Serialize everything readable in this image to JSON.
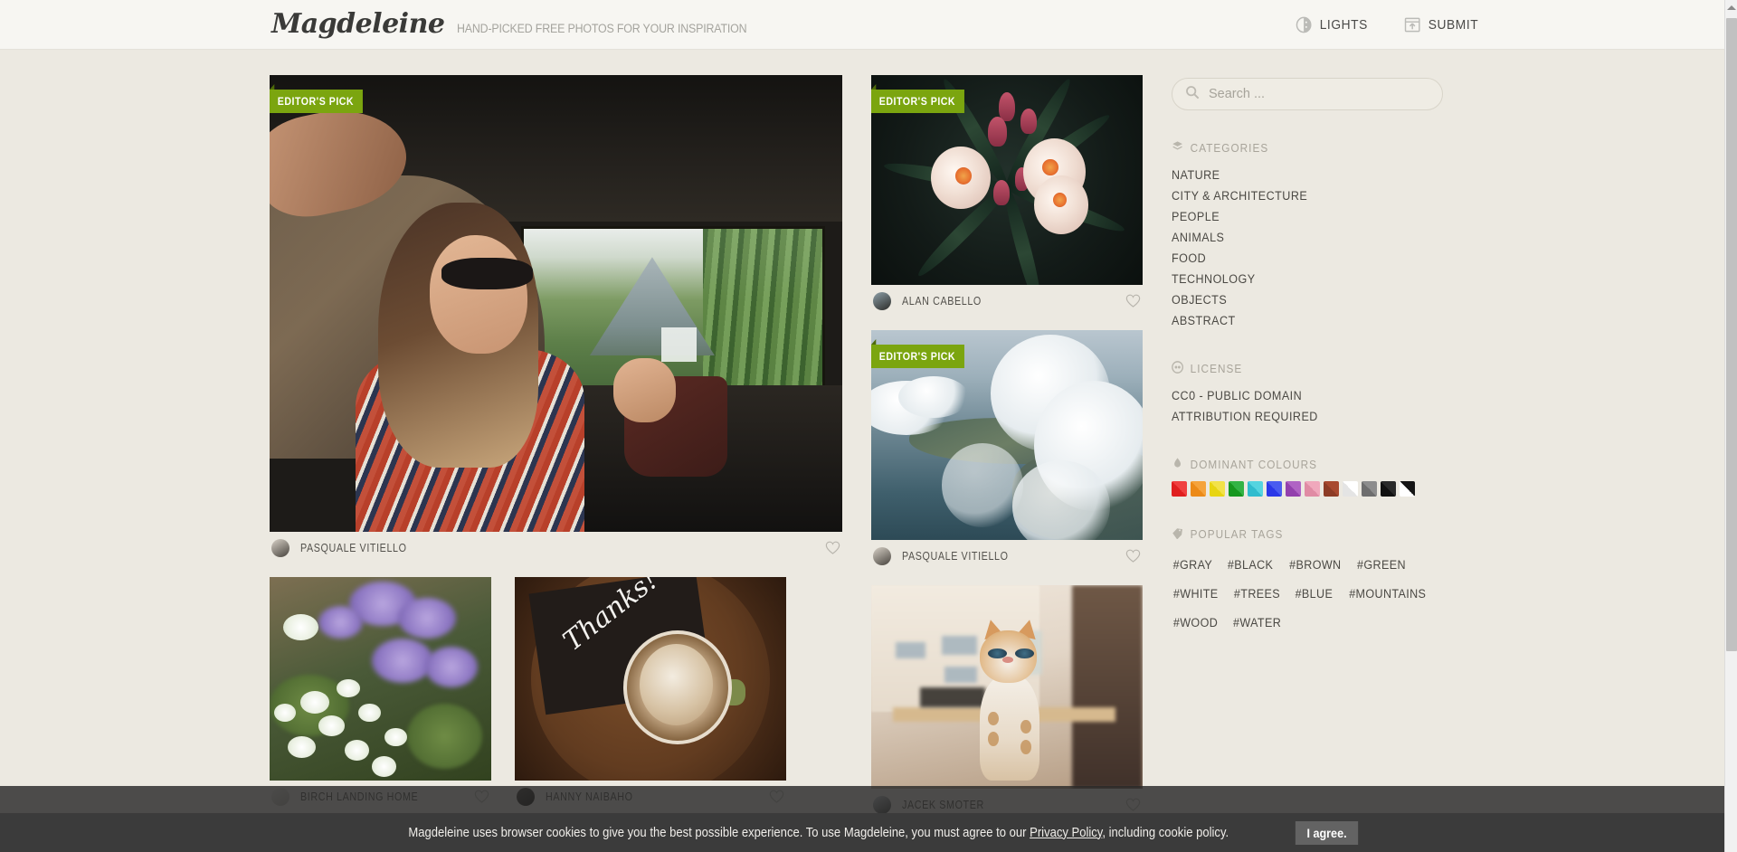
{
  "header": {
    "logo": "Magdeleine",
    "tagline": "HAND-PICKED FREE PHOTOS FOR YOUR INSPIRATION",
    "nav": [
      {
        "label": "LIGHTS",
        "icon": "contrast-icon"
      },
      {
        "label": "SUBMIT",
        "icon": "upload-window-icon"
      }
    ]
  },
  "gallery": {
    "ribbon_label": "EDITOR'S PICK",
    "photos": [
      {
        "id": "hero-woman-in-car",
        "subject": "Woman with sunglasses in a moving car",
        "author": "PASQUALE VITIELLO",
        "editors_pick": true,
        "column": "left",
        "size": "hero"
      },
      {
        "id": "oleander-flowers",
        "subject": "White oleander flowers on dark foliage",
        "author": "ALAN CABELLO",
        "editors_pick": true,
        "column": "right",
        "size": "small"
      },
      {
        "id": "coastline-clouds",
        "subject": "Aerial coastline seen through clouds",
        "author": "PASQUALE VITIELLO",
        "editors_pick": true,
        "column": "right",
        "size": "small"
      },
      {
        "id": "purple-white-flowers",
        "subject": "Purple and white garden flowers",
        "author": "BIRCH LANDING HOME",
        "editors_pick": false,
        "column": "left",
        "size": "square"
      },
      {
        "id": "thanks-coffee",
        "subject": "Latte and Thanks! chalkboard note on wood table",
        "author": "HANNY NAIBAHO",
        "editors_pick": false,
        "column": "left",
        "size": "square"
      },
      {
        "id": "ginger-cat",
        "subject": "Ginger and white cat indoors",
        "author": "JACEK SMOTER",
        "editors_pick": false,
        "column": "right",
        "size": "square"
      }
    ]
  },
  "sidebar": {
    "search": {
      "placeholder": "Search ...",
      "value": "",
      "icon": "search-icon"
    },
    "categories": {
      "title": "CATEGORIES",
      "icon": "layers-icon",
      "items": [
        "NATURE",
        "CITY & ARCHITECTURE",
        "PEOPLE",
        "ANIMALS",
        "FOOD",
        "TECHNOLOGY",
        "OBJECTS",
        "ABSTRACT"
      ]
    },
    "license": {
      "title": "LICENSE",
      "icon": "creative-commons-icon",
      "items": [
        "CC0 - PUBLIC DOMAIN",
        "ATTRIBUTION REQUIRED"
      ]
    },
    "dominant_colours": {
      "title": "DOMINANT COLOURS",
      "icon": "droplet-icon",
      "swatches": [
        {
          "name": "red",
          "light": "#f04040",
          "dark": "#e01f1f"
        },
        {
          "name": "orange",
          "light": "#f5a33c",
          "dark": "#ec8a17"
        },
        {
          "name": "yellow",
          "light": "#f2e24a",
          "dark": "#e8d512"
        },
        {
          "name": "green",
          "light": "#33b345",
          "dark": "#17971f"
        },
        {
          "name": "cyan",
          "light": "#55d4e0",
          "dark": "#30bcce"
        },
        {
          "name": "blue",
          "light": "#4a5cf0",
          "dark": "#2b38e8"
        },
        {
          "name": "purple",
          "light": "#b063c4",
          "dark": "#9340ad"
        },
        {
          "name": "pink",
          "light": "#f0a8bc",
          "dark": "#e08ba4"
        },
        {
          "name": "brown",
          "light": "#a8492f",
          "dark": "#8d3c26"
        },
        {
          "name": "white",
          "light": "#ffffff",
          "dark": "#e4e4e4"
        },
        {
          "name": "gray",
          "light": "#8d8d8d",
          "dark": "#6e6e6e"
        },
        {
          "name": "black",
          "light": "#2a2a2a",
          "dark": "#111111"
        },
        {
          "name": "black-white",
          "light": "#ffffff",
          "dark": "#151515"
        }
      ]
    },
    "popular_tags": {
      "title": "POPULAR TAGS",
      "icon": "tag-icon",
      "tags": [
        "#GRAY",
        "#BLACK",
        "#BROWN",
        "#GREEN",
        "#WHITE",
        "#TREES",
        "#BLUE",
        "#MOUNTAINS",
        "#WOOD",
        "#WATER"
      ]
    }
  },
  "cookie_banner": {
    "text_before_link": "Magdeleine uses browser cookies to give you the best possible experience. To use Magdeleine, you must agree to our ",
    "link_text": "Privacy Policy",
    "text_after_link": ", including cookie policy.",
    "button_label": "I agree."
  },
  "colors": {
    "page_background": "#ece9e1",
    "header_background": "#f7f6f2",
    "ribbon_green": "#7ba50f",
    "banner_background": "#3b3b3b",
    "text": "#3b3b3b"
  }
}
